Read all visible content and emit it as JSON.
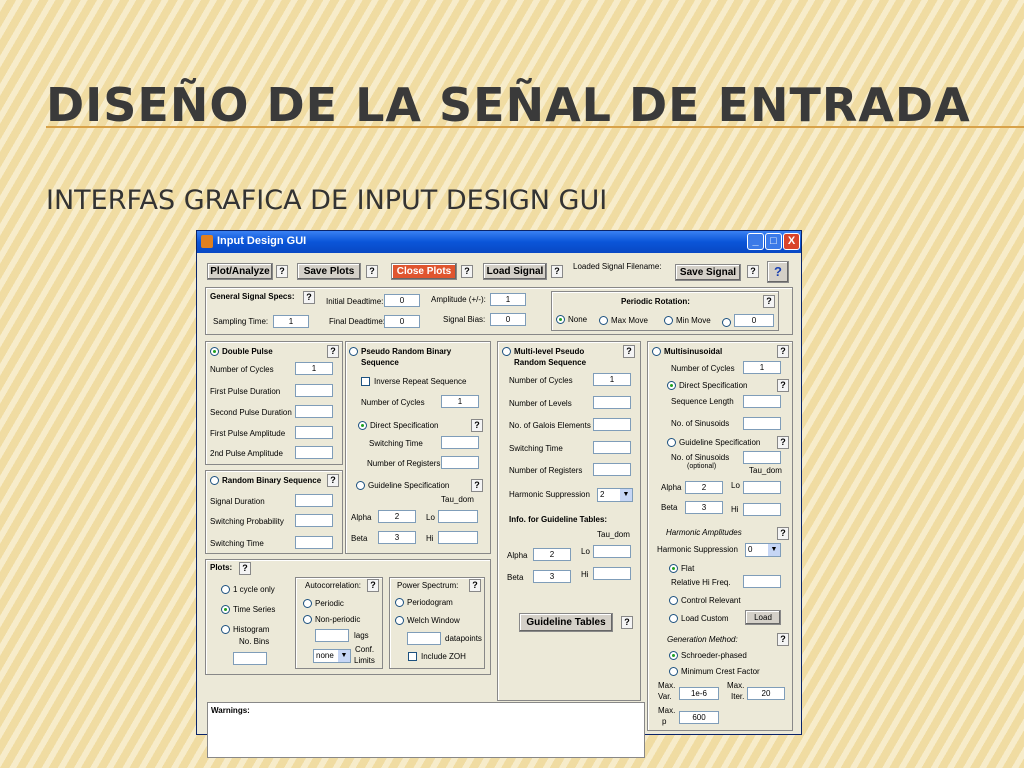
{
  "slide": {
    "title": "DISEÑO DE LA SEÑAL DE ENTRADA",
    "subtitle": "INTERFAS GRAFICA DE INPUT DESIGN GUI"
  },
  "window": {
    "title": "Input Design GUI",
    "min": "_",
    "max": "□",
    "close": "X"
  },
  "toolbar": {
    "plot_analyze": "Plot/Analyze",
    "save_plots": "Save Plots",
    "close_plots": "Close Plots",
    "load_signal": "Load Signal",
    "loaded_label": "Loaded Signal Filename:",
    "save_signal": "Save Signal",
    "help": "?",
    "q": "?"
  },
  "general": {
    "title": "General Signal Specs:",
    "initial_deadtime": "Initial Deadtime:",
    "initial_deadtime_val": "0",
    "amplitude": "Amplitude (+/-):",
    "amplitude_val": "1",
    "sampling_time": "Sampling Time:",
    "sampling_time_val": "1",
    "final_deadtime": "Final Deadtime:",
    "final_deadtime_val": "0",
    "signal_bias": "Signal Bias:",
    "signal_bias_val": "0"
  },
  "periodic": {
    "title": "Periodic Rotation:",
    "none": "None",
    "max_move": "Max Move",
    "min_move": "Min Move",
    "value": "0"
  },
  "double_pulse": {
    "title": "Double Pulse",
    "cycles": "Number of Cycles",
    "cycles_val": "1",
    "first_dur": "First Pulse Duration",
    "second_dur": "Second Pulse Duration",
    "first_amp": "First Pulse Amplitude",
    "second_amp": "2nd Pulse Amplitude"
  },
  "random_binary": {
    "title": "Random Binary Sequence",
    "signal_duration": "Signal Duration",
    "switching_prob": "Switching Probability",
    "switching_time": "Switching Time"
  },
  "prbs": {
    "title1": "Pseudo Random Binary",
    "title2": "Sequence",
    "inverse": "Inverse Repeat Sequence",
    "cycles": "Number of Cycles",
    "cycles_val": "1",
    "direct": "Direct Specification",
    "switching_time": "Switching Time",
    "registers": "Number of Registers",
    "guideline": "Guideline Specification",
    "tau": "Tau_dom",
    "alpha": "Alpha",
    "alpha_val": "2",
    "lo": "Lo",
    "beta": "Beta",
    "beta_val": "3",
    "hi": "Hi"
  },
  "multilevel": {
    "title1": "Multi-level Pseudo",
    "title2": "Random Sequence",
    "cycles": "Number of Cycles",
    "cycles_val": "1",
    "levels": "Number of Levels",
    "galois": "No. of Galois Elements",
    "switching_time": "Switching Time",
    "registers": "Number of Registers",
    "harmonic": "Harmonic Suppression",
    "harmonic_val": "2",
    "info": "Info. for Guideline Tables:",
    "tau": "Tau_dom",
    "alpha": "Alpha",
    "alpha_val": "2",
    "lo": "Lo",
    "beta": "Beta",
    "beta_val": "3",
    "hi": "Hi",
    "tables_button": "Guideline Tables"
  },
  "multisine": {
    "title": "Multisinusoidal",
    "cycles": "Number of Cycles",
    "cycles_val": "1",
    "direct": "Direct Specification",
    "seq_length": "Sequence Length",
    "num_sin": "No. of Sinusoids",
    "guideline": "Guideline Specification",
    "num_sin2": "No. of Sinusoids",
    "optional": "(optional)",
    "tau": "Tau_dom",
    "alpha": "Alpha",
    "alpha_val": "2",
    "lo": "Lo",
    "beta": "Beta",
    "beta_val": "3",
    "hi": "Hi",
    "harm_amp": "Harmonic Amplitudes",
    "harm_supp": "Harmonic Suppression",
    "harm_supp_val": "0",
    "flat": "Flat",
    "rel_hi": "Relative Hi Freq.",
    "control": "Control Relevant",
    "load_custom": "Load Custom",
    "load_btn": "Load",
    "gen_method": "Generation Method:",
    "schroeder": "Schroeder-phased",
    "min_crest": "Minimum Crest Factor",
    "max_var1": "Max.",
    "max_var2": "Var.",
    "max_var_val": "1e-6",
    "max_iter1": "Max.",
    "max_iter2": "Iter.",
    "max_iter_val": "20",
    "max_p1": "Max.",
    "max_p2": "p",
    "max_p_val": "600"
  },
  "plots": {
    "title": "Plots:",
    "one_cycle": "1 cycle only",
    "time_series": "Time Series",
    "histogram": "Histogram",
    "bins": "No. Bins",
    "autocorr": "Autocorrelation:",
    "periodic": "Periodic",
    "nonperiodic": "Non-periodic",
    "lags": "lags",
    "conf_val": "none",
    "conf1": "Conf.",
    "conf2": "Limits",
    "power": "Power Spectrum:",
    "periodogram": "Periodogram",
    "welch": "Welch Window",
    "datapoints": "datapoints",
    "zoh": "Include ZOH"
  },
  "warnings": {
    "label": "Warnings:"
  }
}
